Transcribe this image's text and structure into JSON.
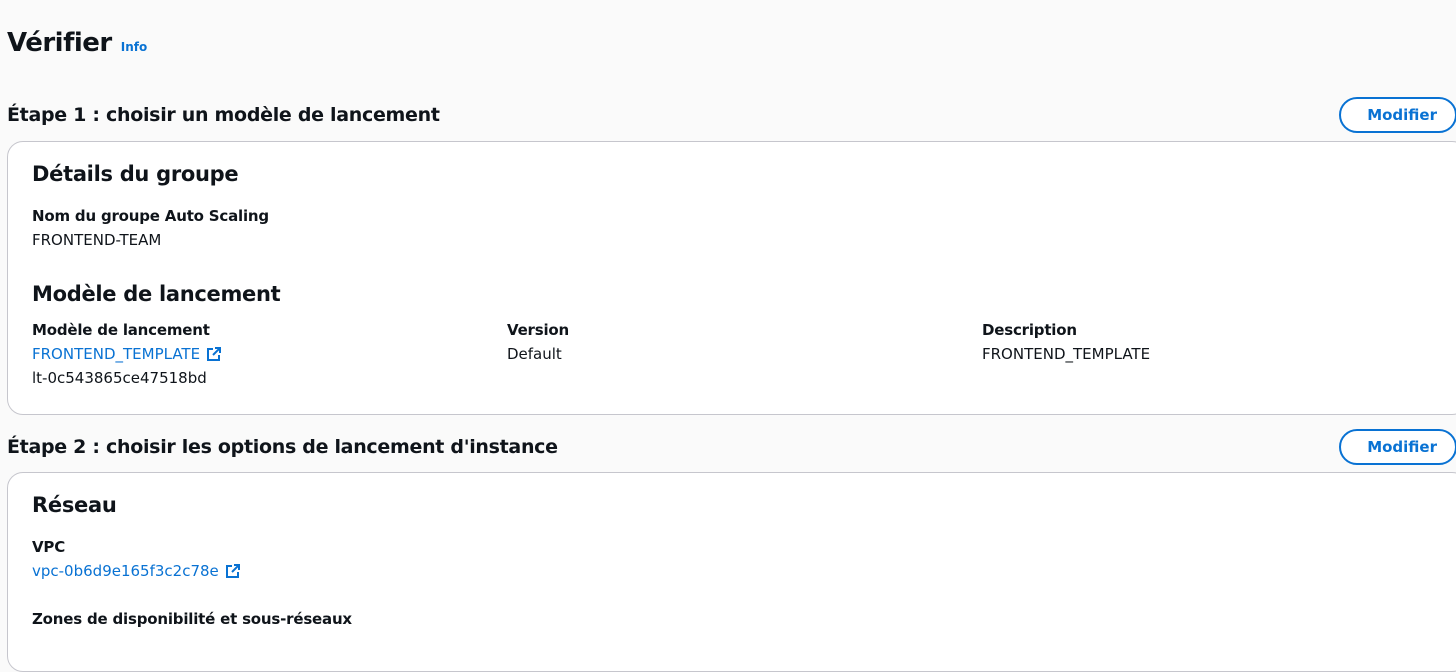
{
  "page": {
    "title": "Vérifier",
    "info_label": "Info"
  },
  "step1": {
    "title": "Étape 1 : choisir un modèle de lancement",
    "modify_label": "Modifier",
    "group_details": {
      "heading": "Détails du groupe",
      "name_label": "Nom du groupe Auto Scaling",
      "name_value": "FRONTEND-TEAM"
    },
    "launch_template": {
      "heading": "Modèle de lancement",
      "template_label": "Modèle de lancement",
      "template_link": "FRONTEND_TEMPLATE",
      "template_id": "lt-0c543865ce47518bd",
      "version_label": "Version",
      "version_value": "Default",
      "description_label": "Description",
      "description_value": "FRONTEND_TEMPLATE"
    }
  },
  "step2": {
    "title": "Étape 2 : choisir les options de lancement d'instance",
    "modify_label": "Modifier",
    "network": {
      "heading": "Réseau",
      "vpc_label": "VPC",
      "vpc_link": "vpc-0b6d9e165f3c2c78e",
      "zones_label": "Zones de disponibilité et sous-réseaux"
    }
  },
  "icons": {
    "external_link": "external-link-icon"
  },
  "colors": {
    "accent": "#0972d3",
    "text": "#0f141a",
    "background": "#fafafa",
    "card_border": "#c6c6cd"
  }
}
